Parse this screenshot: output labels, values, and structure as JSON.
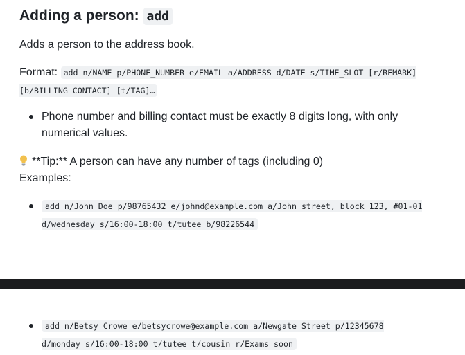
{
  "heading": {
    "text": "Adding a person: ",
    "code": "add"
  },
  "intro": "Adds a person to the address book.",
  "format": {
    "label": "Format: ",
    "code": "add n/NAME p/PHONE_NUMBER e/EMAIL a/ADDRESS d/DATE s/TIME_SLOT [r/REMARK] [b/BILLING_CONTACT] [t/TAG]…"
  },
  "notes": [
    "Phone number and billing contact must be exactly 8 digits long, with only numerical values."
  ],
  "tip": {
    "icon": "lightbulb-icon",
    "text": "**Tip:** A person can have any number of tags (including 0)"
  },
  "examples_label": "Examples:",
  "examples": [
    "add n/John Doe p/98765432 e/johnd@example.com a/John street, block 123, #01-01 d/wednesday s/16:00-18:00 t/tutee b/98226544",
    "add n/Betsy Crowe e/betsycrowe@example.com a/Newgate Street p/12345678 d/monday s/16:00-18:00 t/tutee t/cousin r/Exams soon"
  ],
  "colors": {
    "code_bg": "#eff1f3",
    "divider": "#1b1c1e",
    "text": "#1f2328",
    "bulb": "#f2c14e"
  }
}
